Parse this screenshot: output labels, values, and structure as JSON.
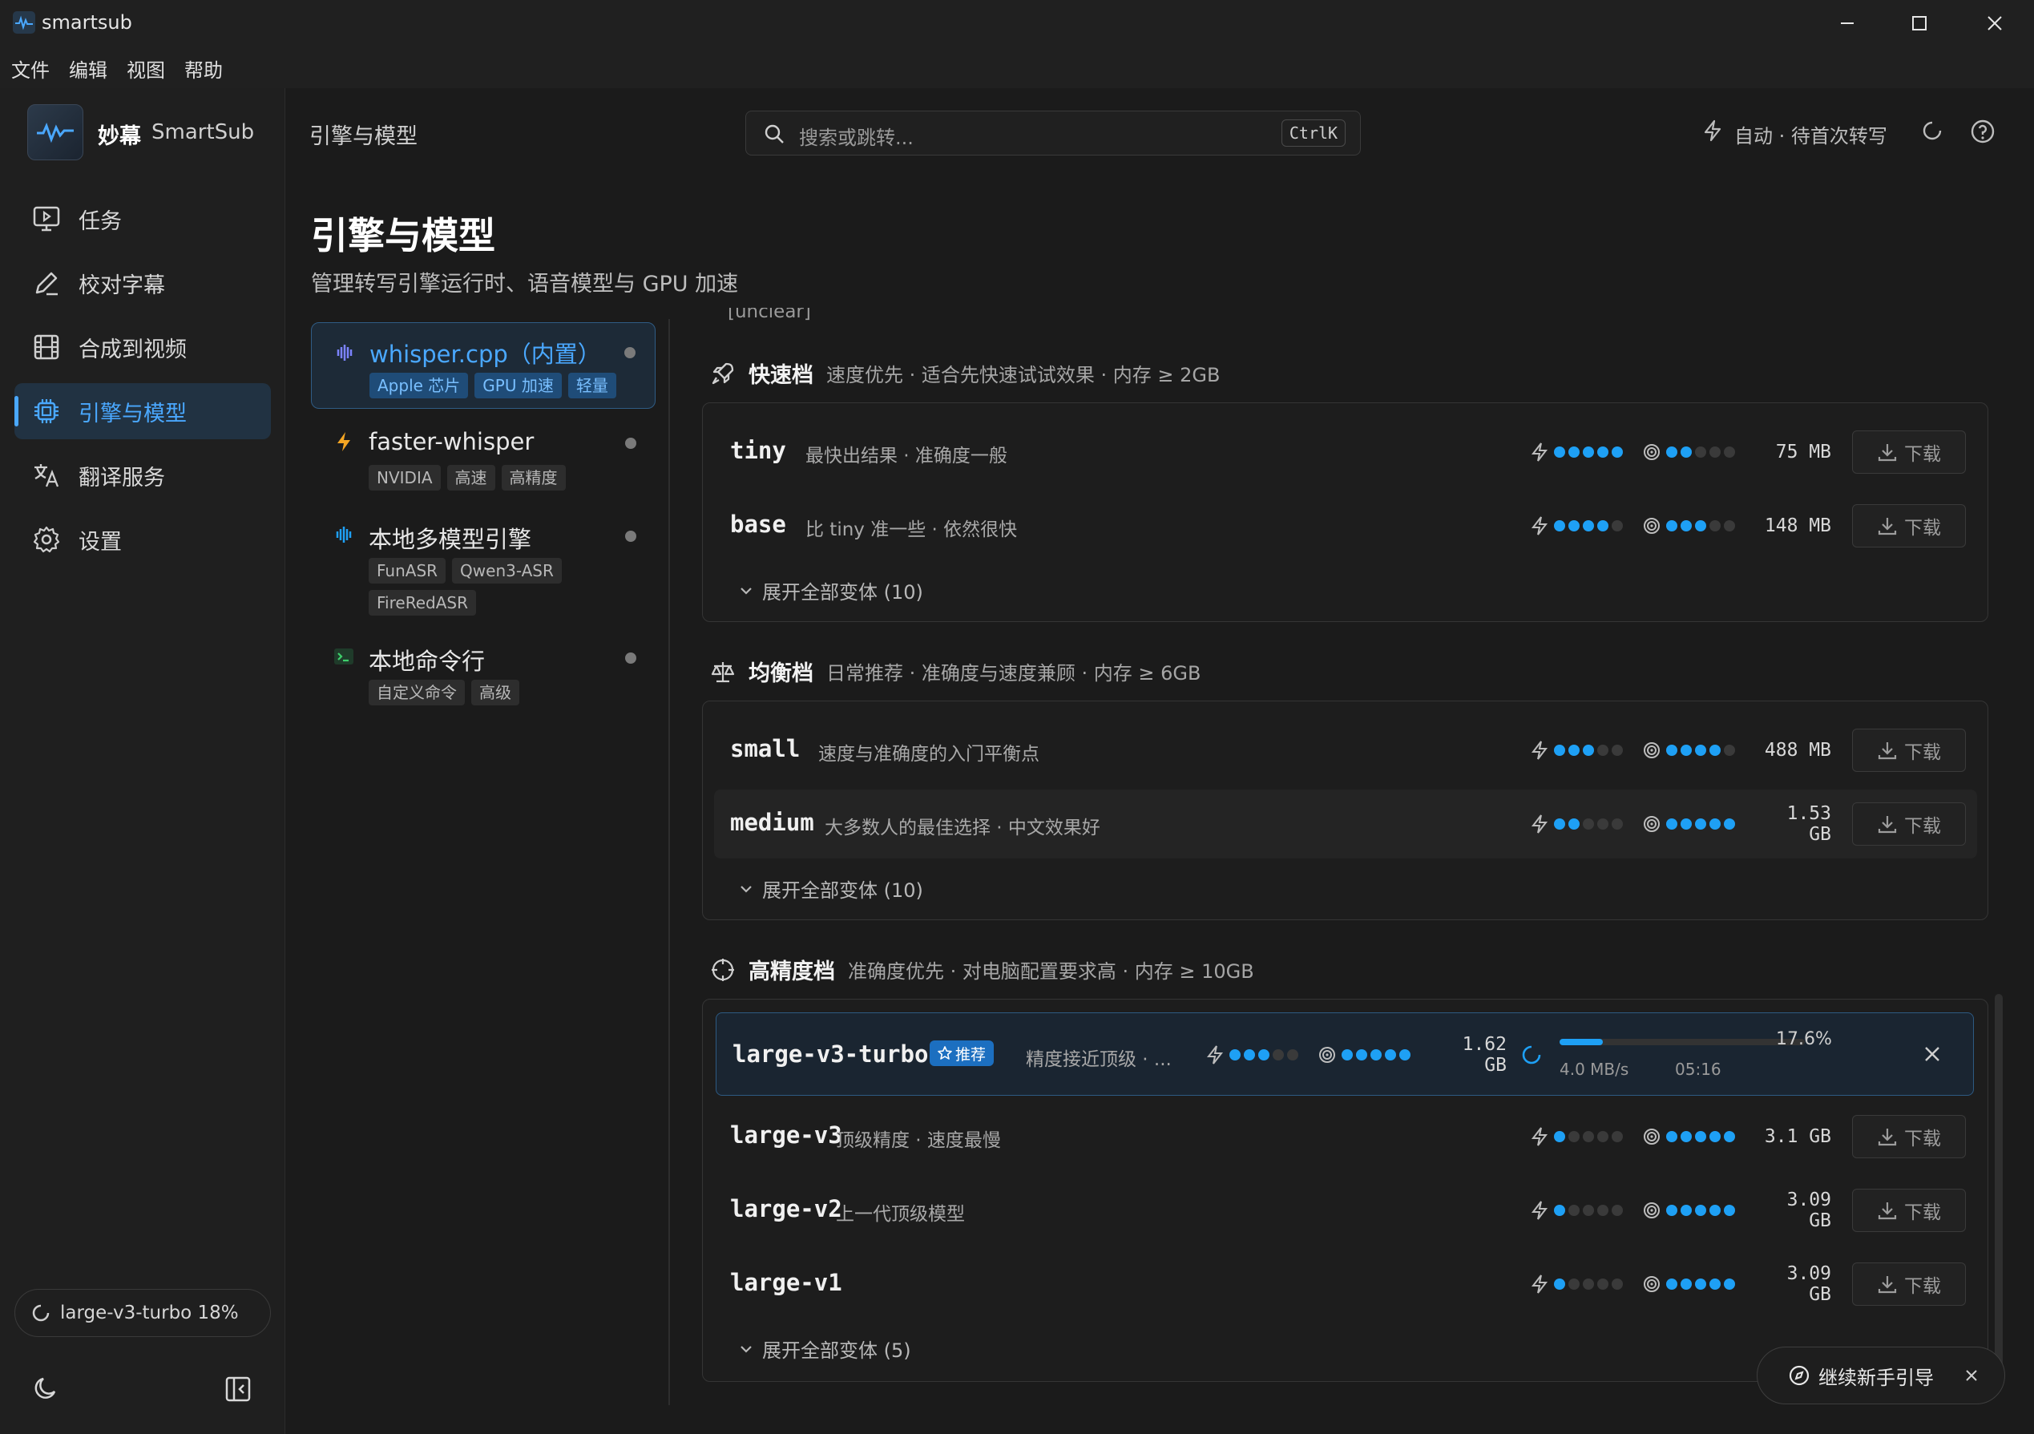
{
  "window": {
    "title": "smartsub"
  },
  "menu": [
    "文件",
    "编辑",
    "视图",
    "帮助"
  ],
  "brand": {
    "name": "妙幕",
    "sub": "SmartSub"
  },
  "nav": [
    {
      "label": "任务",
      "icon": "monitor-play-icon"
    },
    {
      "label": "校对字幕",
      "icon": "pen-icon"
    },
    {
      "label": "合成到视频",
      "icon": "film-icon"
    },
    {
      "label": "引擎与模型",
      "icon": "chip-icon",
      "active": true
    },
    {
      "label": "翻译服务",
      "icon": "translate-icon"
    },
    {
      "label": "设置",
      "icon": "gear-icon"
    }
  ],
  "sidebar_download": {
    "label": "large-v3-turbo 18%"
  },
  "header": {
    "breadcrumb": "引擎与模型",
    "search_placeholder": "搜索或跳转...",
    "shortcut": "CtrlK",
    "status": "自动 · 待首次转写"
  },
  "page": {
    "title": "引擎与模型",
    "subtitle": "管理转写引擎运行时、语音模型与 GPU 加速"
  },
  "engines": [
    {
      "name": "whisper.cpp（内置）",
      "tags": [
        "Apple 芯片",
        "GPU 加速",
        "轻量"
      ],
      "active": true
    },
    {
      "name": "faster-whisper",
      "tags": [
        "NVIDIA",
        "高速",
        "高精度"
      ]
    },
    {
      "name": "本地多模型引擎",
      "tags": [
        "FunASR",
        "Qwen3-ASR",
        "FireRedASR"
      ]
    },
    {
      "name": "本地命令行",
      "tags": [
        "自定义命令",
        "高级"
      ]
    }
  ],
  "clipped_line": "[unclear]",
  "sections": [
    {
      "title": "快速档",
      "desc": "速度优先 · 适合先快速试试效果 · 内存 ≥ 2GB",
      "models": [
        {
          "name": "tiny",
          "desc": "最快出结果 · 准确度一般",
          "speed": 5,
          "accuracy": 2,
          "size": "75 MB",
          "action": "下载"
        },
        {
          "name": "base",
          "desc": "比 tiny 准一些 · 依然很快",
          "speed": 4,
          "accuracy": 3,
          "size": "148 MB",
          "action": "下载"
        }
      ],
      "expand": "展开全部变体 (10)"
    },
    {
      "title": "均衡档",
      "desc": "日常推荐 · 准确度与速度兼顾 · 内存 ≥ 6GB",
      "models": [
        {
          "name": "small",
          "desc": "速度与准确度的入门平衡点",
          "speed": 3,
          "accuracy": 4,
          "size": "488 MB",
          "action": "下载"
        },
        {
          "name": "medium",
          "desc": "大多数人的最佳选择 · 中文效果好",
          "speed": 2,
          "accuracy": 5,
          "size": "1.53 GB",
          "action": "下载"
        }
      ],
      "expand": "展开全部变体 (10)"
    },
    {
      "title": "高精度档",
      "desc": "准确度优先 · 对电脑配置要求高 · 内存 ≥ 10GB",
      "downloading": {
        "name": "large-v3-turbo",
        "badge": "推荐",
        "desc": "精度接近顶级 · ...",
        "speed": 3,
        "accuracy": 5,
        "size": "1.62 GB",
        "progress_label": "17.6%",
        "progress": 0.176,
        "rate": "4.0 MB/s",
        "eta": "05:16"
      },
      "models": [
        {
          "name": "large-v3",
          "desc": "顶级精度 · 速度最慢",
          "speed": 1,
          "accuracy": 5,
          "size": "3.1 GB",
          "action": "下载"
        },
        {
          "name": "large-v2",
          "desc": "上一代顶级模型",
          "speed": 1,
          "accuracy": 5,
          "size": "3.09 GB",
          "action": "下载"
        },
        {
          "name": "large-v1",
          "desc": "",
          "speed": 1,
          "accuracy": 5,
          "size": "3.09 GB",
          "action": "下载"
        }
      ],
      "expand": "展开全部变体 (5)"
    }
  ],
  "guide": {
    "label": "继续新手引导"
  },
  "colors": {
    "accent": "#4aa8ff",
    "dot_on": "#1ea0f5",
    "dot_off": "#3a3a3a",
    "badge": "#1c6fc0"
  }
}
